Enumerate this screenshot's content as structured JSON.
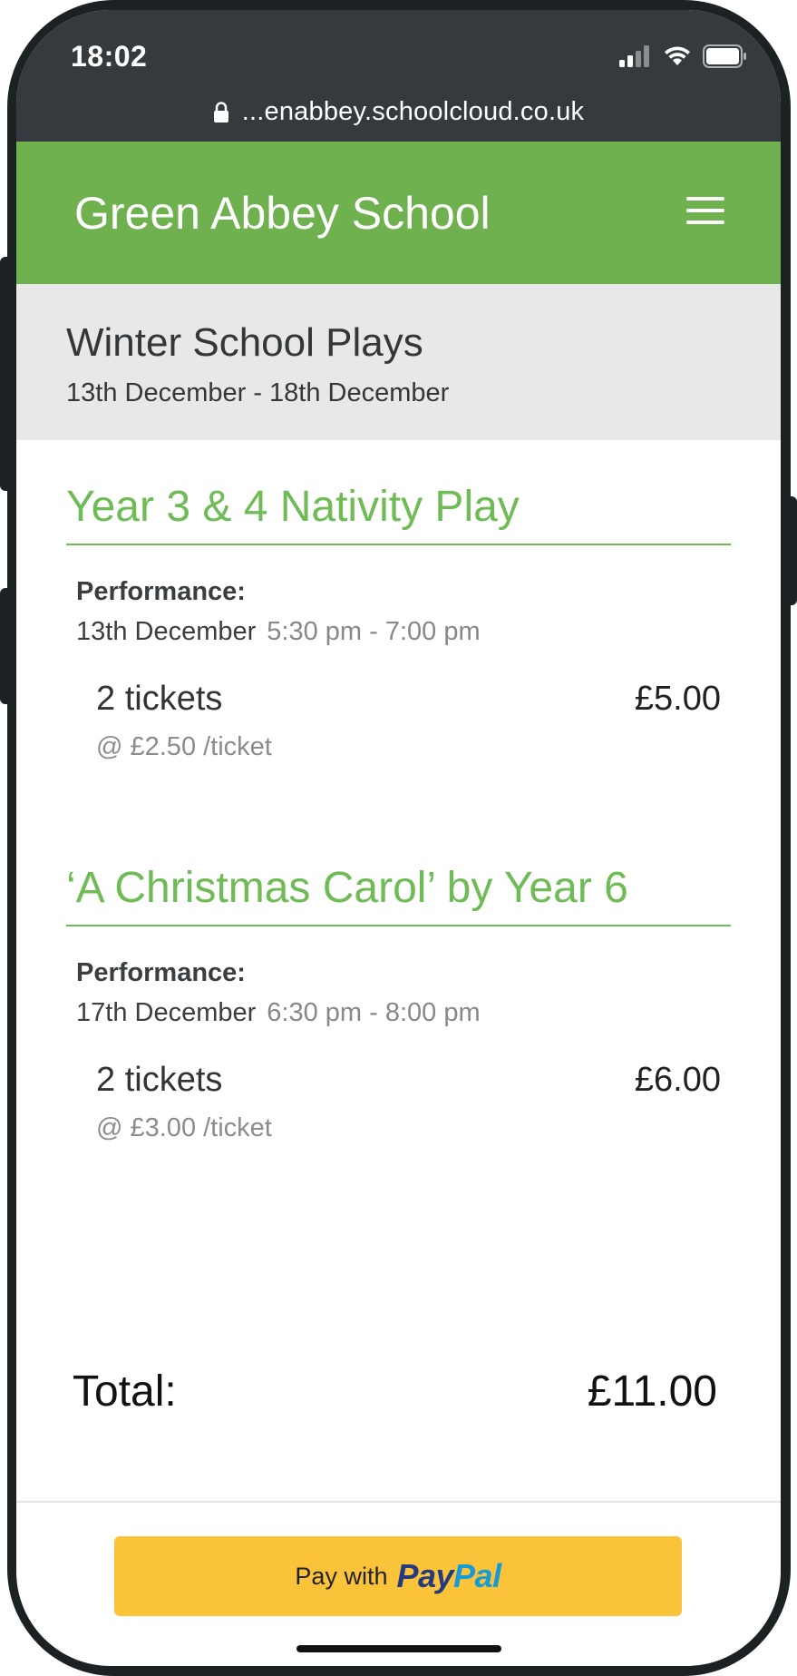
{
  "status_bar": {
    "time": "18:02",
    "url": "...enabbey.schoolcloud.co.uk",
    "icons": [
      "signal-icon",
      "wifi-icon",
      "battery-icon",
      "lock-icon"
    ]
  },
  "header": {
    "title": "Green Abbey School",
    "menu_icon": "hamburger-menu-icon",
    "background_color": "#6fb04f"
  },
  "event": {
    "title": "Winter School Plays",
    "dates": "13th December - 18th December"
  },
  "bookings": [
    {
      "title": "Year 3 & 4 Nativity Play",
      "performance_label": "Performance:",
      "date": "13th December",
      "time": "5:30 pm - 7:00 pm",
      "tickets": "2 tickets",
      "unit_price": "@ £2.50 /ticket",
      "subtotal": "£5.00"
    },
    {
      "title": "‘A Christmas Carol’ by Year 6",
      "performance_label": "Performance:",
      "date": "17th December",
      "time": "6:30 pm - 8:00 pm",
      "tickets": "2 tickets",
      "unit_price": "@ £3.00 /ticket",
      "subtotal": "£6.00"
    }
  ],
  "total": {
    "label": "Total:",
    "value": "£11.00"
  },
  "payment": {
    "prefix": "Pay with",
    "brand_part1": "Pay",
    "brand_part2": "Pal",
    "button_color": "#fbc33a"
  }
}
